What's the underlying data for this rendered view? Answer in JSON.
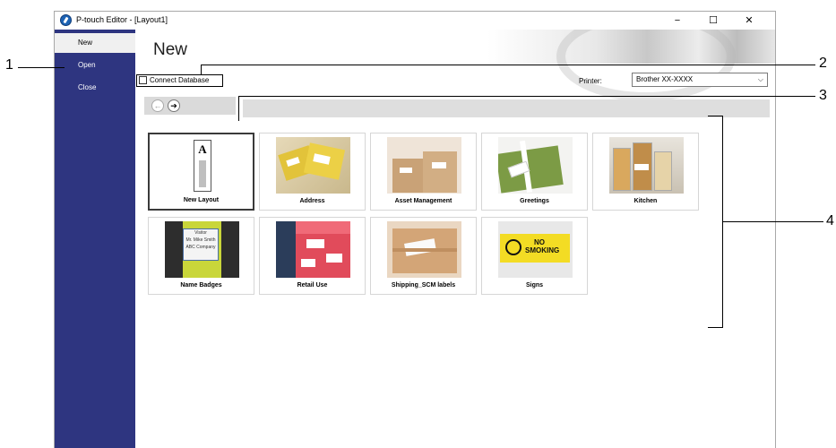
{
  "window": {
    "title": "P-touch Editor - [Layout1]",
    "controls": {
      "minimize": "−",
      "maximize": "☐",
      "close": "✕"
    }
  },
  "sidebar": {
    "items": [
      {
        "label": "New",
        "active": true
      },
      {
        "label": "Open",
        "active": false
      },
      {
        "label": "Close",
        "active": false
      }
    ]
  },
  "main": {
    "title": "New",
    "connect_database": {
      "label": "Connect Database",
      "checked": false
    },
    "printer": {
      "label": "Printer:",
      "value": "Brother XX-XXXX"
    },
    "nav": {
      "back": "←",
      "forward": "➔"
    }
  },
  "templates": [
    {
      "label": "New Layout",
      "selected": true
    },
    {
      "label": "Address"
    },
    {
      "label": "Asset Management"
    },
    {
      "label": "Greetings"
    },
    {
      "label": "Kitchen"
    },
    {
      "label": "Name Badges"
    },
    {
      "label": "Retail Use"
    },
    {
      "label": "Shipping_SCM labels"
    },
    {
      "label": "Signs"
    }
  ],
  "thumbnails": {
    "new_layout_letter": "A",
    "badge_lines": [
      "Visitor",
      "Mr. Mike Smith",
      "ABC Company"
    ],
    "sign_text": [
      "NO",
      "SMOKING"
    ]
  },
  "callouts": [
    "1",
    "2",
    "3",
    "4"
  ]
}
